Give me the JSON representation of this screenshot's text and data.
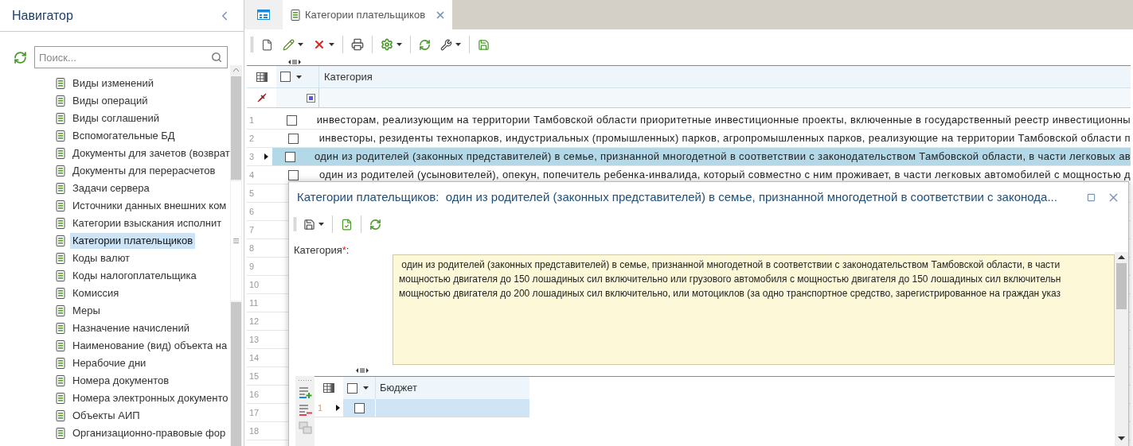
{
  "navigator": {
    "title": "Навигатор",
    "search": {
      "placeholder": "Поиск..."
    },
    "items": [
      {
        "label": "Виды изменений",
        "selected": false
      },
      {
        "label": "Виды операций",
        "selected": false
      },
      {
        "label": "Виды соглашений",
        "selected": false
      },
      {
        "label": "Вспомогательные БД",
        "selected": false
      },
      {
        "label": "Документы для зачетов (возврат",
        "selected": false
      },
      {
        "label": "Документы для перерасчетов",
        "selected": false
      },
      {
        "label": "Задачи сервера",
        "selected": false
      },
      {
        "label": "Источники данных внешних ком",
        "selected": false
      },
      {
        "label": "Категории взыскания исполнит",
        "selected": false
      },
      {
        "label": "Категории плательщиков",
        "selected": true
      },
      {
        "label": "Коды валют",
        "selected": false
      },
      {
        "label": "Коды налогоплательщика",
        "selected": false
      },
      {
        "label": "Комиссия",
        "selected": false
      },
      {
        "label": "Меры",
        "selected": false
      },
      {
        "label": "Назначение начислений",
        "selected": false
      },
      {
        "label": "Наименование (вид) объекта на",
        "selected": false
      },
      {
        "label": "Нерабочие дни",
        "selected": false
      },
      {
        "label": "Номера документов",
        "selected": false
      },
      {
        "label": "Номера электронных документо",
        "selected": false
      },
      {
        "label": "Объекты АИП",
        "selected": false
      },
      {
        "label": "Организационно-правовые фор",
        "selected": false
      }
    ]
  },
  "tabs": [
    {
      "kind": "icon",
      "selected": false
    },
    {
      "kind": "text",
      "label": "Категории плательщиков",
      "selected": true
    }
  ],
  "grid": {
    "columns": [
      "Категория"
    ],
    "select_all_checked": false,
    "rows": [
      {
        "number": "1",
        "checked": false,
        "selected": false,
        "text": "инвесторам, реализующим на территории Тамбовской области приоритетные инвестиционные проекты, включенные в государственный реестр инвестиционны"
      },
      {
        "number": "2",
        "checked": false,
        "selected": false,
        "text": "инвесторы, резиденты технопарков, индустриальных (промышленных) парков, агропромышленных парков, реализующие на территории Тамбовской области п"
      },
      {
        "number": "3",
        "checked": false,
        "selected": true,
        "text": "один из родителей (законных представителей) в семье, признанной многодетной в соответствии с законодательством Тамбовской области, в части легковых ав"
      },
      {
        "number": "4",
        "checked": false,
        "selected": false,
        "text": "один из родителей (усыновителей), опекун, попечитель ребенка-инвалида, который совместно с ним проживает, в части легковых автомобилей с мощностью д"
      },
      {
        "number": "5",
        "selected": false
      },
      {
        "number": "6",
        "selected": false
      },
      {
        "number": "7",
        "selected": false
      },
      {
        "number": "8",
        "selected": false
      },
      {
        "number": "9",
        "selected": false
      },
      {
        "number": "10",
        "selected": false
      },
      {
        "number": "11",
        "selected": false
      },
      {
        "number": "12",
        "selected": false
      },
      {
        "number": "13",
        "selected": false
      },
      {
        "number": "14",
        "selected": false
      },
      {
        "number": "15",
        "selected": false
      },
      {
        "number": "16",
        "selected": false
      },
      {
        "number": "17",
        "selected": false
      },
      {
        "number": "18",
        "selected": false
      }
    ]
  },
  "dialog": {
    "title": "Категории плательщиков:  один из родителей (законных представителей) в семье, признанной многодетной в соответствии с законода...",
    "field": {
      "label": "Категория",
      "required_mark": "*",
      "suffix": ":",
      "lines": [
        " один из родителей (законных представителей) в семье, признанной многодетной в соответствии с законодательством Тамбовской области, в части",
        "мощностью двигателя до 150 лошадиных сил включительно или грузового автомобиля с мощностью двигателя до 150 лошадиных сил включительн",
        "мощностью двигателя до 200 лошадиных сил включительно, или мотоциклов (за одно транспортное средство, зарегистрированное на граждан указ"
      ]
    },
    "subgrid": {
      "columns": [
        "Бюджет"
      ],
      "select_all_checked": false,
      "rows": [
        {
          "number": "1",
          "checked": false,
          "selected": true
        }
      ]
    }
  }
}
